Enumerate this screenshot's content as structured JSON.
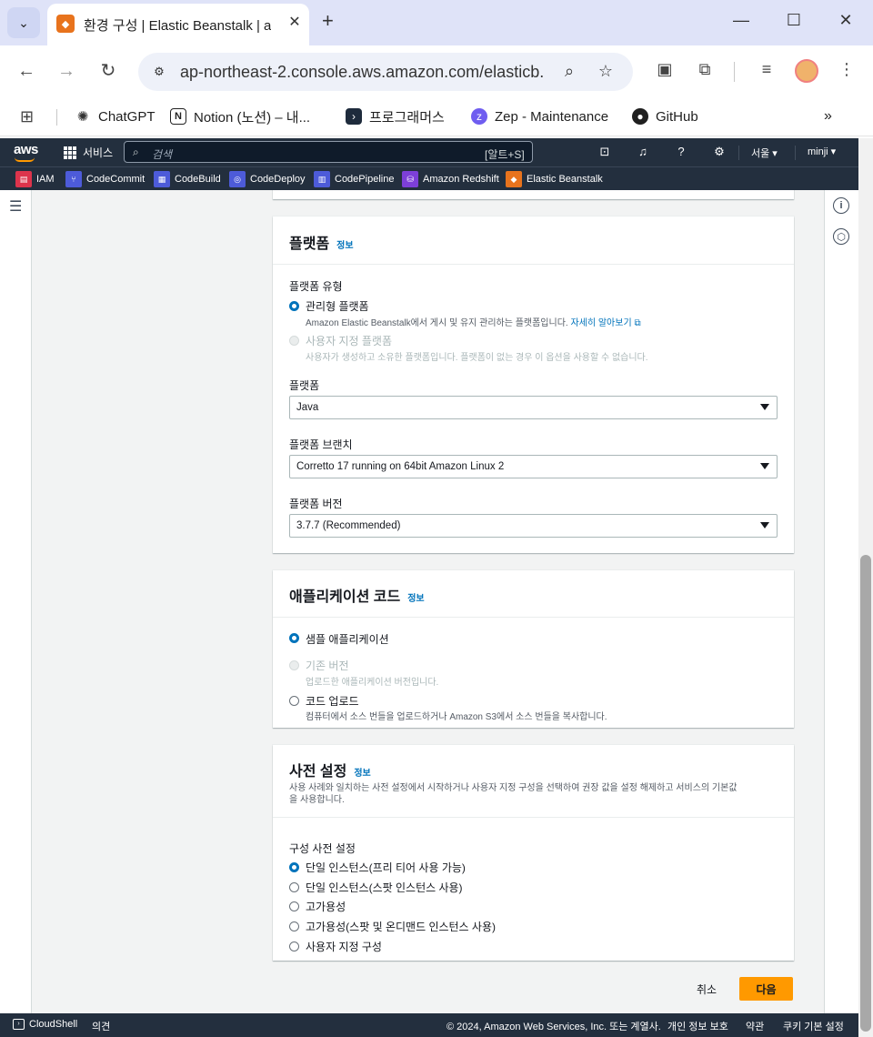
{
  "browser": {
    "tab_title": "환경 구성 | Elastic Beanstalk | a",
    "url": "ap-northeast-2.console.aws.amazon.com/elasticb...",
    "bookmarks": [
      {
        "label": "ChatGPT",
        "icon": "chatgpt-icon"
      },
      {
        "label": "Notion (노션) – 내...",
        "icon": "notion-icon"
      },
      {
        "label": "프로그래머스",
        "icon": "programmers-icon"
      },
      {
        "label": "Zep - Maintenance",
        "icon": "zep-icon"
      },
      {
        "label": "GitHub",
        "icon": "github-icon"
      }
    ]
  },
  "aws_header": {
    "logo": "aws",
    "services": "서비스",
    "search_placeholder": "검색",
    "search_shortcut": "[알트+S]",
    "region": "서울",
    "user": "minji",
    "favorites": [
      "IAM",
      "CodeCommit",
      "CodeBuild",
      "CodeDeploy",
      "CodePipeline",
      "Amazon Redshift",
      "Elastic Beanstalk"
    ]
  },
  "platform": {
    "title": "플랫폼",
    "info": "정보",
    "type_label": "플랫폼 유형",
    "managed": {
      "label": "관리형 플랫폼",
      "desc": "Amazon Elastic Beanstalk에서 게시 및 유지 관리하는 플랫폼입니다.",
      "link": "자세히 알아보기"
    },
    "custom": {
      "label": "사용자 지정 플랫폼",
      "desc": "사용자가 생성하고 소유한 플랫폼입니다. 플랫폼이 없는 경우 이 옵션을 사용할 수 없습니다."
    },
    "platform_label": "플랫폼",
    "platform_value": "Java",
    "branch_label": "플랫폼 브랜치",
    "branch_value": "Corretto 17 running on 64bit Amazon Linux 2",
    "version_label": "플랫폼 버전",
    "version_value": "3.7.7 (Recommended)"
  },
  "app_code": {
    "title": "애플리케이션 코드",
    "info": "정보",
    "sample": "샘플 애플리케이션",
    "existing": "기존 버전",
    "existing_desc": "업로드한 애플리케이션 버전입니다.",
    "upload": "코드 업로드",
    "upload_desc": "컴퓨터에서 소스 번들을 업로드하거나 Amazon S3에서 소스 번들을 복사합니다."
  },
  "presets": {
    "title": "사전 설정",
    "info": "정보",
    "desc_line1": "사용 사례와 일치하는 사전 설정에서 시작하거나 사용자 지정 구성을 선택하여 권장 값을 설정 해제하고 서비스의 기본값",
    "desc_line2": "을 사용합니다.",
    "config_label": "구성 사전 설정",
    "options": [
      "단일 인스턴스(프리 티어 사용 가능)",
      "단일 인스턴스(스팟 인스턴스 사용)",
      "고가용성",
      "고가용성(스팟 및 온디맨드 인스턴스 사용)",
      "사용자 지정 구성"
    ]
  },
  "actions": {
    "cancel": "취소",
    "next": "다음"
  },
  "footer": {
    "cloudshell": "CloudShell",
    "feedback": "의견",
    "copyright": "© 2024, Amazon Web Services, Inc. 또는 계열사.",
    "privacy": "개인 정보 보호",
    "terms": "약관",
    "cookies": "쿠키 기본 설정"
  },
  "colors": {
    "aws_nav": "#232f3e",
    "primary_button": "#ff9900",
    "link": "#0073bb"
  }
}
